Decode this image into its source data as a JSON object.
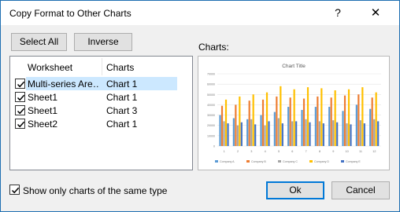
{
  "window": {
    "title": "Copy Format to Other Charts",
    "help_glyph": "?",
    "close_glyph": "✕"
  },
  "toolbar": {
    "select_all_label": "Select All",
    "inverse_label": "Inverse"
  },
  "list": {
    "columns": [
      "Worksheet",
      "Charts"
    ],
    "rows": [
      {
        "worksheet": "Multi-series Are…",
        "chart": "Chart 1",
        "checked": true,
        "selected": true
      },
      {
        "worksheet": "Sheet1",
        "chart": "Chart 1",
        "checked": true,
        "selected": false
      },
      {
        "worksheet": "Sheet1",
        "chart": "Chart 3",
        "checked": true,
        "selected": false
      },
      {
        "worksheet": "Sheet2",
        "chart": "Chart 1",
        "checked": true,
        "selected": false
      }
    ]
  },
  "preview": {
    "label": "Charts:"
  },
  "chart_data": {
    "type": "bar",
    "title": "Chart Title",
    "categories": [
      "1",
      "2",
      "3",
      "4",
      "5",
      "6",
      "7",
      "8",
      "9",
      "10",
      "11",
      "12"
    ],
    "ylim": [
      0,
      70000
    ],
    "yticks": [
      0,
      10000,
      20000,
      30000,
      40000,
      50000,
      60000,
      70000
    ],
    "grid": true,
    "legend_position": "bottom",
    "series": [
      {
        "name": "Company A",
        "color": "#5b9bd5",
        "values": [
          30000,
          27000,
          26000,
          30000,
          33000,
          38000,
          35000,
          38000,
          38000,
          34000,
          40000,
          36000
        ]
      },
      {
        "name": "Company B",
        "color": "#ed7d31",
        "values": [
          39000,
          40000,
          44000,
          45000,
          48000,
          47000,
          46000,
          48000,
          47000,
          49000,
          50000,
          47000
        ]
      },
      {
        "name": "Company C",
        "color": "#a5a5a5",
        "values": [
          24000,
          20000,
          26000,
          20000,
          27000,
          24000,
          26000,
          24000,
          25000,
          22000,
          25000,
          26000
        ]
      },
      {
        "name": "Company D",
        "color": "#ffc000",
        "values": [
          45000,
          48000,
          50000,
          52000,
          58000,
          55000,
          57000,
          56000,
          54000,
          55000,
          57000,
          52000
        ]
      },
      {
        "name": "Company E",
        "color": "#4472c4",
        "values": [
          22000,
          23000,
          21000,
          24000,
          22000,
          24000,
          23000,
          22000,
          23000,
          21000,
          22000,
          24000
        ]
      }
    ]
  },
  "footer": {
    "only_same_type_label": "Show only charts of the same type",
    "only_same_type_checked": true,
    "ok_label": "Ok",
    "cancel_label": "Cancel"
  }
}
